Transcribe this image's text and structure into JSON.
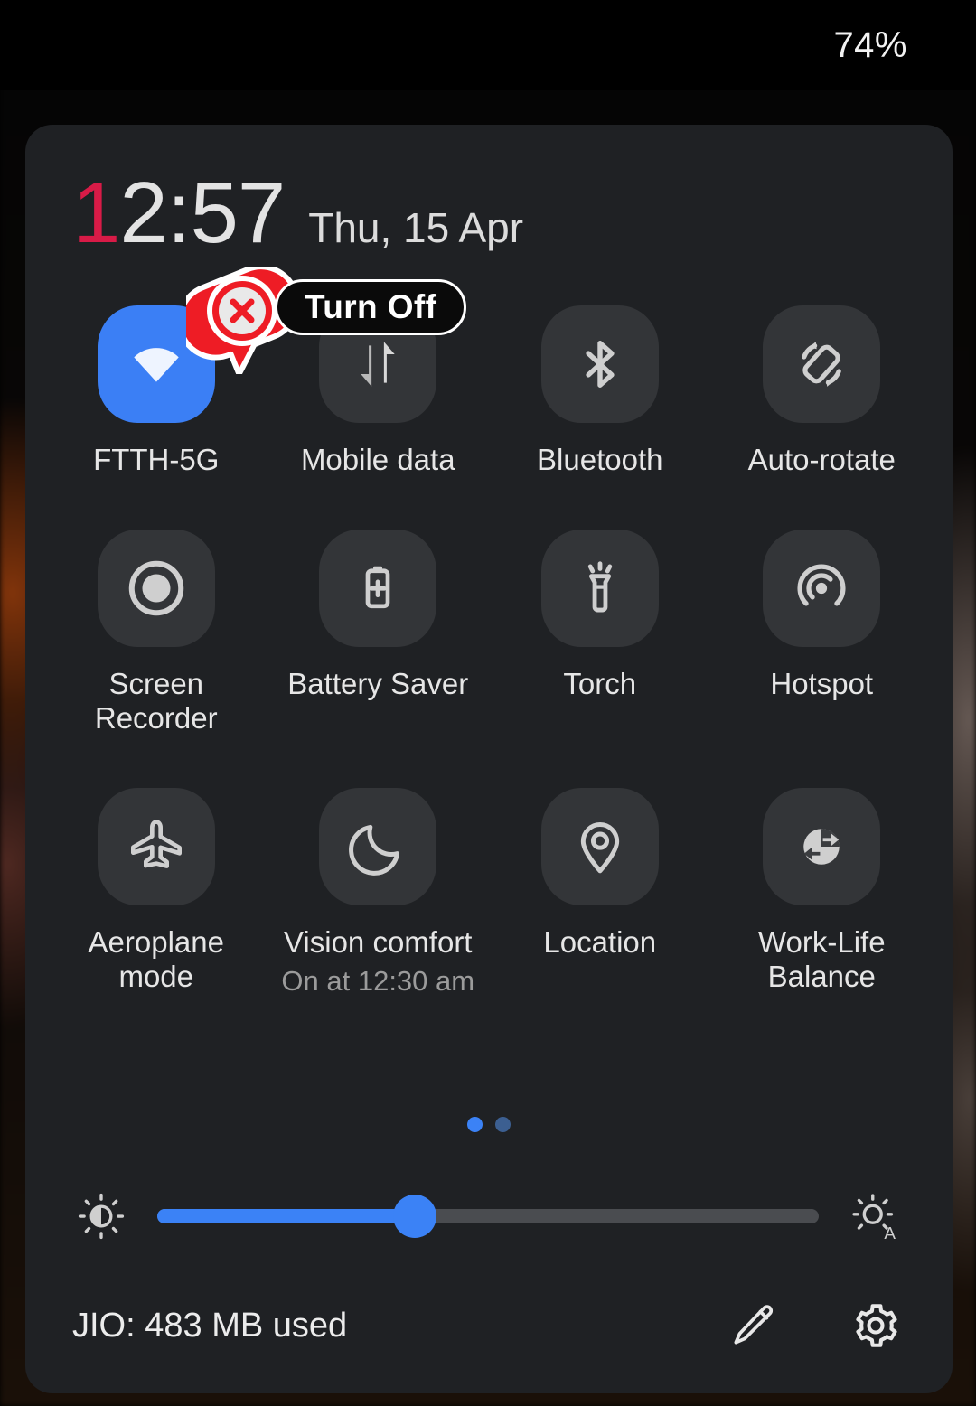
{
  "status_bar": {
    "battery_percent": "74%"
  },
  "header": {
    "time": "12:57",
    "time_highlight_digit": "1",
    "time_rest": "2:57",
    "date": "Thu, 15 Apr",
    "highlight_color": "#d81b47"
  },
  "annotation": {
    "label": "Turn Off",
    "marker_icon": "close-x-icon",
    "marker_color": "#ee1c25",
    "target_tile": "FTTH-5G"
  },
  "tiles": [
    {
      "label": "FTTH-5G",
      "sub": "",
      "icon": "wifi-icon",
      "state": "on",
      "accent": "#3b7ff5"
    },
    {
      "label": "Mobile data",
      "sub": "",
      "icon": "mobile-data-icon",
      "state": "off",
      "accent": ""
    },
    {
      "label": "Bluetooth",
      "sub": "",
      "icon": "bluetooth-icon",
      "state": "off",
      "accent": ""
    },
    {
      "label": "Auto-rotate",
      "sub": "",
      "icon": "auto-rotate-icon",
      "state": "off",
      "accent": ""
    },
    {
      "label": "Screen Recorder",
      "sub": "",
      "icon": "screen-recorder-icon",
      "state": "off",
      "accent": ""
    },
    {
      "label": "Battery Saver",
      "sub": "",
      "icon": "battery-saver-icon",
      "state": "off",
      "accent": ""
    },
    {
      "label": "Torch",
      "sub": "",
      "icon": "torch-icon",
      "state": "off",
      "accent": ""
    },
    {
      "label": "Hotspot",
      "sub": "",
      "icon": "hotspot-icon",
      "state": "off",
      "accent": ""
    },
    {
      "label": "Aeroplane mode",
      "sub": "",
      "icon": "airplane-icon",
      "state": "off",
      "accent": ""
    },
    {
      "label": "Vision comfort",
      "sub": "On at 12:30 am",
      "icon": "moon-icon",
      "state": "off",
      "accent": ""
    },
    {
      "label": "Location",
      "sub": "",
      "icon": "location-pin-icon",
      "state": "off",
      "accent": ""
    },
    {
      "label": "Work-Life Balance",
      "sub": "",
      "icon": "work-life-balance-icon",
      "state": "off",
      "accent": ""
    }
  ],
  "pager": {
    "pages": 2,
    "active_index": 0
  },
  "brightness": {
    "value_percent": 39,
    "left_icon": "brightness-icon",
    "right_icon": "auto-brightness-icon",
    "track_color": "#3b82f6"
  },
  "bottom_bar": {
    "data_usage": "JIO: 483 MB used",
    "edit_icon": "pencil-icon",
    "settings_icon": "gear-icon"
  }
}
